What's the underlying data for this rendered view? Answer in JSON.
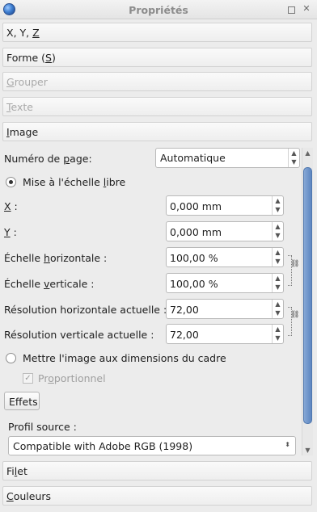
{
  "window": {
    "title": "Propriétés",
    "icon": "app-globe-icon"
  },
  "sections": {
    "xyz": {
      "label": "X, Y, Z",
      "enabled": true
    },
    "forme": {
      "label": "Forme (S)",
      "enabled": true
    },
    "grouper": {
      "label": "Grouper",
      "enabled": false
    },
    "texte": {
      "label": "Texte",
      "enabled": false
    },
    "image": {
      "label": "Image",
      "enabled": true
    },
    "filet": {
      "label": "Filet",
      "enabled": true
    },
    "couleurs": {
      "label": "Couleurs",
      "enabled": true
    }
  },
  "image_panel": {
    "page_number_label": "Numéro de page:",
    "page_number_value": "Automatique",
    "free_scaling_label": "Mise à l'échelle libre",
    "free_scaling_checked": true,
    "x_label": "X :",
    "x_value": "0,000 mm",
    "y_label": "Y :",
    "y_value": "0,000 mm",
    "hscale_label": "Échelle horizontale :",
    "hscale_value": "100,00 %",
    "vscale_label": "Échelle verticale :",
    "vscale_value": "100,00 %",
    "hres_label": "Résolution horizontale actuelle :",
    "hres_value": "72,00",
    "vres_label": "Résolution verticale actuelle :",
    "vres_value": "72,00",
    "fit_frame_label": "Mettre l'image aux dimensions du cadre",
    "fit_frame_checked": false,
    "proportional_label": "Proportionnel",
    "proportional_checked": true,
    "effects_button": "Effets",
    "source_profile_label": "Profil source :",
    "source_profile_value": "Compatible with Adobe RGB (1998)"
  }
}
